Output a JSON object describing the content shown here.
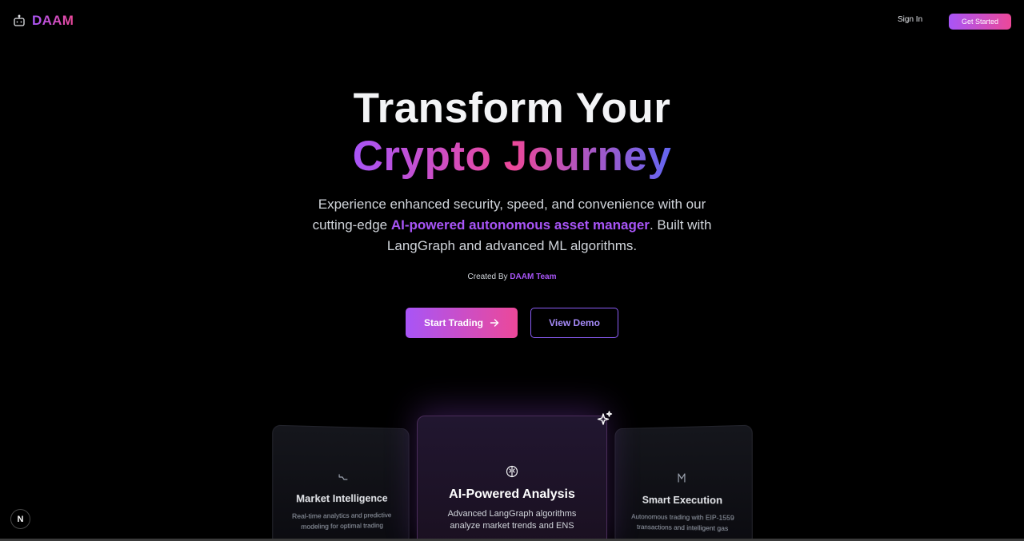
{
  "header": {
    "logo_icon": "bot-icon",
    "brand": "DAAM",
    "sign_in": "Sign In",
    "get_started": "Get Started"
  },
  "hero": {
    "title_line1": "Transform Your",
    "title_line2": "Crypto Journey",
    "desc_part1": "Experience enhanced security, speed, and convenience with our cutting-edge ",
    "desc_highlight": "AI-powered autonomous asset manager",
    "desc_part2": ". Built with LangGraph and advanced ML algorithms.",
    "created_prefix": "Created By ",
    "created_team": "DAAM Team",
    "start_trading": "Start Trading",
    "view_demo": "View Demo"
  },
  "cards": [
    {
      "icon": "trend-line-icon",
      "title": "Market Intelligence",
      "desc": "Real-time analytics and predictive modeling for optimal trading"
    },
    {
      "icon": "brain-icon",
      "title": "AI-Powered Analysis",
      "desc": "Advanced LangGraph algorithms analyze market trends and ENS"
    },
    {
      "icon": "bolt-icon",
      "title": "Smart Execution",
      "desc": "Autonomous trading with EIP-1559 transactions and intelligent gas"
    }
  ],
  "badge": "N",
  "colors": {
    "accent_purple": "#a855f7",
    "accent_pink": "#ec4899",
    "accent_indigo": "#6366f1",
    "background": "#000000"
  }
}
